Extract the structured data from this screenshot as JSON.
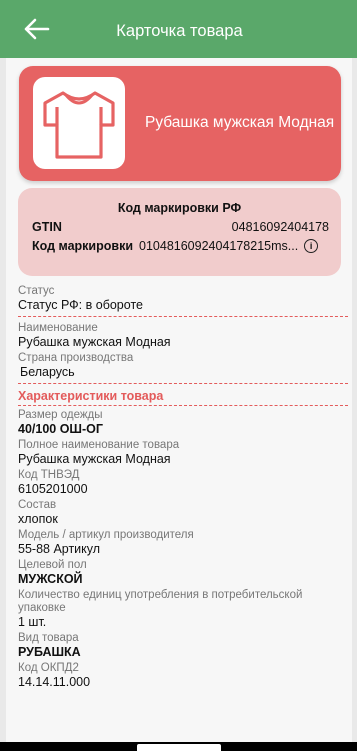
{
  "header": {
    "title": "Карточка товара",
    "back_icon": "arrow-left-icon"
  },
  "hero": {
    "product_name": "Рубашка мужская Модная",
    "image_icon": "tshirt-icon",
    "color": "#e66363"
  },
  "marking": {
    "title": "Код маркировки РФ",
    "gtin_label": "GTIN",
    "gtin_value": "04816092404178",
    "code_label": "Код маркировки",
    "code_value": "0104816092404178215ms...",
    "info_icon": "info-icon"
  },
  "fields": [
    {
      "label": "Статус",
      "value": "Статус РФ: в обороте"
    },
    {
      "label": "Наименование",
      "value": "Рубашка мужская Модная"
    },
    {
      "label": "Страна производства",
      "value": "Беларусь"
    }
  ],
  "characteristics": {
    "title": "Характеристики товара",
    "items": [
      {
        "label": "Размер одежды",
        "value": "40/100 ОШ-ОГ"
      },
      {
        "label": "Полное наименование товара",
        "value": "Рубашка мужская Модная"
      },
      {
        "label": "Код ТНВЭД",
        "value": "6105201000"
      },
      {
        "label": "Состав",
        "value": "хлопок"
      },
      {
        "label": "Модель / артикул производителя",
        "value": "55-88 Артикул"
      },
      {
        "label": "Целевой пол",
        "value": "МУЖСКОЙ"
      },
      {
        "label": "Количество единиц употребления в потребительской упаковке",
        "value": "1 шт."
      },
      {
        "label": "Вид товара",
        "value": "РУБАШКА"
      },
      {
        "label": "Код ОКПД2",
        "value": "14.14.11.000"
      }
    ]
  },
  "colors": {
    "header": "#5aa86a",
    "accent": "#e35b5b",
    "mark_bg": "#f1cccc"
  }
}
